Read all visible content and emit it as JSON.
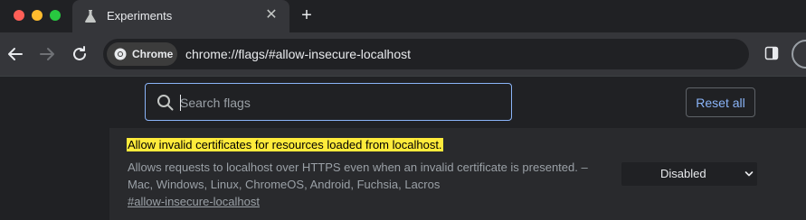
{
  "window": {
    "tab": {
      "title": "Experiments",
      "icon": "flask-icon",
      "close_glyph": "✕"
    },
    "new_tab_glyph": "+"
  },
  "toolbar": {
    "chip_label": "Chrome",
    "url_prefix": "chrome://",
    "url_host": "flags",
    "url_rest": "/#allow-insecure-localhost"
  },
  "header": {
    "search_placeholder": "Search flags",
    "reset_label": "Reset all"
  },
  "flag": {
    "title": "Allow invalid certificates for resources loaded from localhost.",
    "description": "Allows requests to localhost over HTTPS even when an invalid certificate is presented. – Mac, Windows, Linux, ChromeOS, Android, Fuchsia, Lacros",
    "link": "#allow-insecure-localhost",
    "select_value": "Disabled"
  },
  "colors": {
    "accent": "#8ab4f8",
    "highlight": "#ffeb3b",
    "background": "#202124",
    "card": "#292a2d"
  }
}
